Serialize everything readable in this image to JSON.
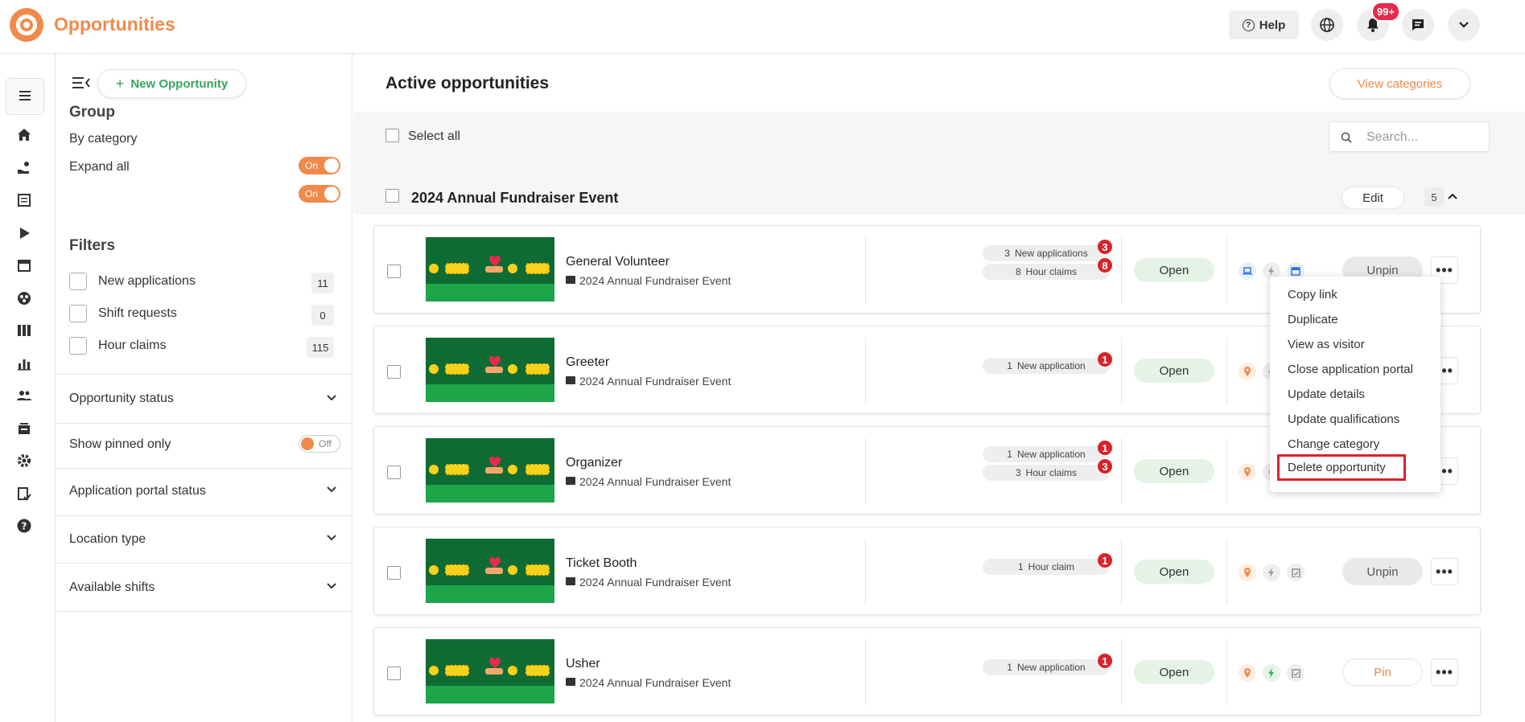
{
  "app": {
    "title": "Opportunities"
  },
  "topbar": {
    "help_label": "Help",
    "notifications_badge": "99+"
  },
  "sidebar": {
    "new_opportunity_label": "New Opportunity",
    "group_heading": "Group",
    "by_category_label": "By category",
    "by_category_toggle": "On",
    "expand_all_label": "Expand all",
    "expand_all_toggle": "On",
    "filters_heading": "Filters",
    "filters": [
      {
        "label": "New applications",
        "count": "11"
      },
      {
        "label": "Shift requests",
        "count": "0"
      },
      {
        "label": "Hour claims",
        "count": "115"
      }
    ],
    "opportunity_status_label": "Opportunity status",
    "show_pinned_label": "Show pinned only",
    "show_pinned_toggle": "Off",
    "application_portal_label": "Application portal status",
    "location_type_label": "Location type",
    "available_shifts_label": "Available shifts"
  },
  "main": {
    "title": "Active opportunities",
    "view_categories_label": "View categories",
    "select_all_label": "Select all",
    "search_placeholder": "Search...",
    "group": {
      "name": "2024 Annual Fundraiser Event",
      "edit_label": "Edit",
      "count": "5"
    },
    "cards": [
      {
        "name": "General Volunteer",
        "category": "2024 Annual Fundraiser Event",
        "pills": [
          {
            "num": "3",
            "text": "New applications",
            "badge": "3"
          },
          {
            "num": "8",
            "text": "Hour claims",
            "badge": "8"
          }
        ],
        "status": "Open",
        "pin_label": "Unpin"
      },
      {
        "name": "Greeter",
        "category": "2024 Annual Fundraiser Event",
        "pills": [
          {
            "num": "1",
            "text": "New application",
            "badge": "1"
          }
        ],
        "status": "Open",
        "pin_label": ""
      },
      {
        "name": "Organizer",
        "category": "2024 Annual Fundraiser Event",
        "pills": [
          {
            "num": "1",
            "text": "New application",
            "badge": "1"
          },
          {
            "num": "3",
            "text": "Hour claims",
            "badge": "3"
          }
        ],
        "status": "Open",
        "pin_label": ""
      },
      {
        "name": "Ticket Booth",
        "category": "2024 Annual Fundraiser Event",
        "pills": [
          {
            "num": "1",
            "text": "Hour claim",
            "badge": "1"
          }
        ],
        "status": "Open",
        "pin_label": "Unpin"
      },
      {
        "name": "Usher",
        "category": "2024 Annual Fundraiser Event",
        "pills": [
          {
            "num": "1",
            "text": "New application",
            "badge": "1"
          }
        ],
        "status": "Open",
        "pin_label": "Pin"
      }
    ]
  },
  "menu": {
    "items": [
      "Copy link",
      "Duplicate",
      "View as visitor",
      "Close application portal",
      "Update details",
      "Update qualifications",
      "Change category",
      "Delete opportunity"
    ]
  },
  "colors": {
    "brand": "#f08a4b",
    "green": "#35a65a",
    "danger": "#d8232a"
  }
}
